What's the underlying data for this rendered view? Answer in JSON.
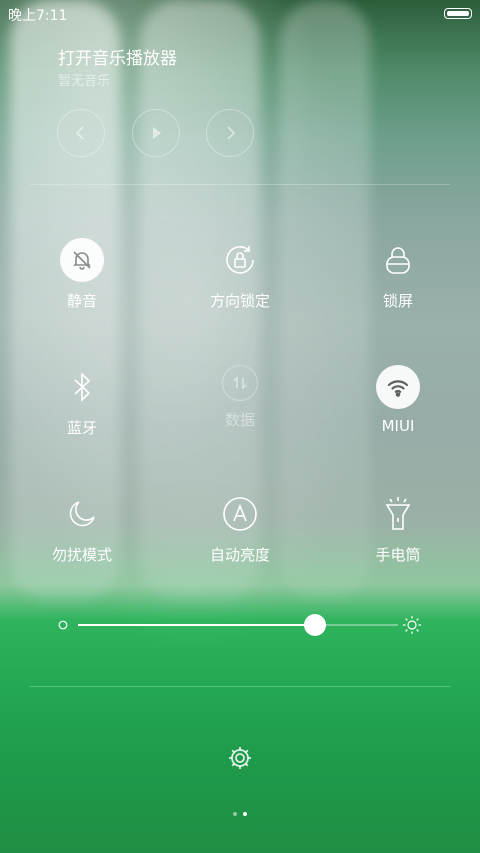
{
  "status_bar": {
    "time": "晚上7:11"
  },
  "music": {
    "title": "打开音乐播放器",
    "subtitle": "暂无音乐",
    "controls": [
      "prev-icon",
      "play-icon",
      "next-icon"
    ]
  },
  "toggles": [
    {
      "label": "静音",
      "icon": "mute-bell-icon",
      "active": true
    },
    {
      "label": "方向锁定",
      "icon": "rotation-lock-icon",
      "active": false
    },
    {
      "label": "锁屏",
      "icon": "lock-icon",
      "active": false
    },
    {
      "label": "蓝牙",
      "icon": "bluetooth-icon",
      "active": false
    },
    {
      "label": "数据",
      "icon": "mobile-data-icon",
      "active": false,
      "disabled": true
    },
    {
      "label": "MIUI",
      "icon": "wifi-icon",
      "active": true
    },
    {
      "label": "勿扰模式",
      "icon": "moon-icon",
      "active": false
    },
    {
      "label": "自动亮度",
      "icon": "auto-brightness-icon",
      "active": false
    },
    {
      "label": "手电筒",
      "icon": "flashlight-icon",
      "active": false
    }
  ],
  "brightness": {
    "level": 0.74
  },
  "settings_icon": "gear-icon",
  "pager": {
    "pages": 2,
    "current": 2
  }
}
